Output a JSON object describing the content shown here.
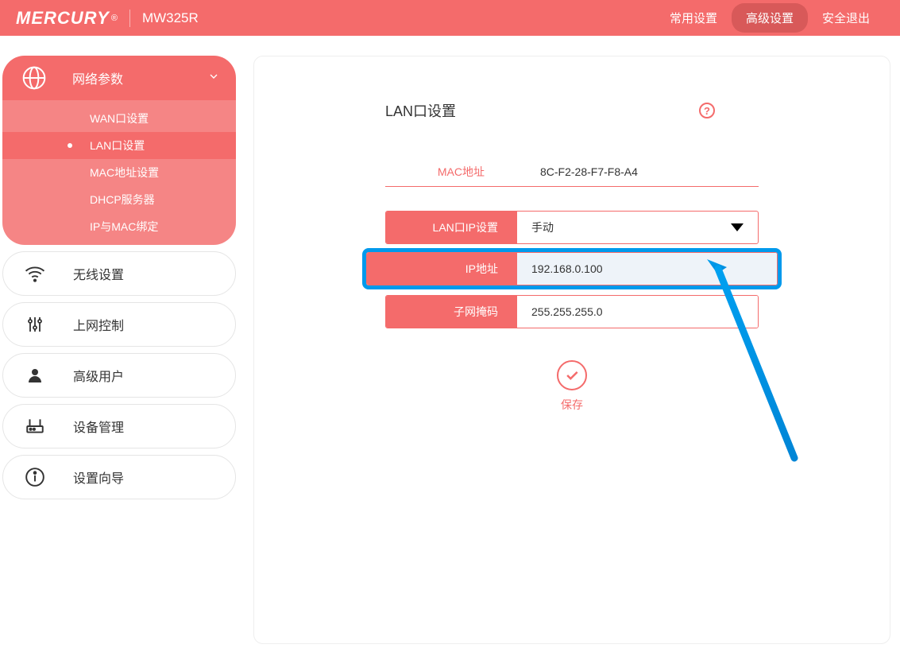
{
  "header": {
    "brand": "MERCURY",
    "model": "MW325R",
    "nav": {
      "common": "常用设置",
      "advanced": "高级设置",
      "logout": "安全退出"
    }
  },
  "sidebar": {
    "items": [
      {
        "label": "网络参数",
        "icon": "globe-icon",
        "expanded": true
      },
      {
        "label": "无线设置",
        "icon": "wifi-icon"
      },
      {
        "label": "上网控制",
        "icon": "sliders-icon"
      },
      {
        "label": "高级用户",
        "icon": "user-icon"
      },
      {
        "label": "设备管理",
        "icon": "router-icon"
      },
      {
        "label": "设置向导",
        "icon": "info-icon"
      }
    ],
    "submenu": [
      "WAN口设置",
      "LAN口设置",
      "MAC地址设置",
      "DHCP服务器",
      "IP与MAC绑定"
    ]
  },
  "main": {
    "title": "LAN口设置",
    "mac_label": "MAC地址",
    "mac_value": "8C-F2-28-F7-F8-A4",
    "lan_ip_setting_label": "LAN口IP设置",
    "lan_ip_setting_value": "手动",
    "ip_label": "IP地址",
    "ip_value": "192.168.0.100",
    "subnet_label": "子网掩码",
    "subnet_value": "255.255.255.0",
    "save_label": "保存"
  },
  "colors": {
    "accent": "#f46b6b",
    "highlight": "#0099ec"
  }
}
